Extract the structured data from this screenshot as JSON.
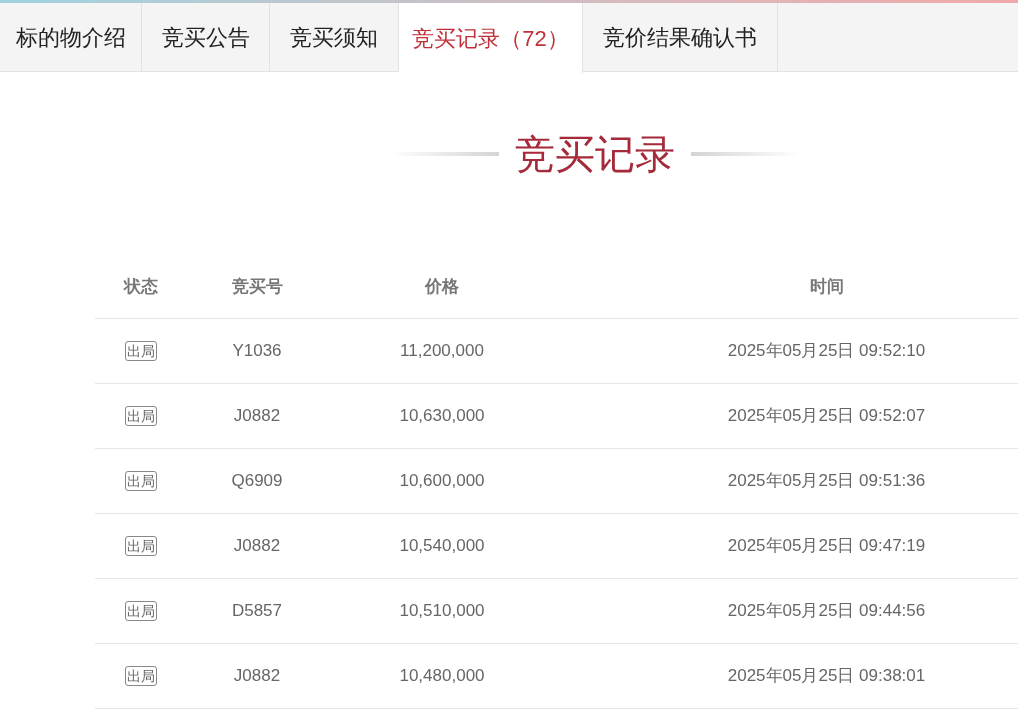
{
  "tabs": [
    {
      "label": "标的物介绍",
      "selected": false
    },
    {
      "label": "竞买公告",
      "selected": false
    },
    {
      "label": "竞买须知",
      "selected": false
    },
    {
      "label": "竞买记录（72）",
      "selected": true
    },
    {
      "label": "竞价结果确认书",
      "selected": false
    }
  ],
  "section_title": "竞买记录",
  "table": {
    "columns": [
      "状态",
      "竞买号",
      "价格",
      "时间"
    ],
    "rows": [
      {
        "status": "出局",
        "bidder": "Y1036",
        "price": "11,200,000",
        "time": "2025年05月25日 09:52:10"
      },
      {
        "status": "出局",
        "bidder": "J0882",
        "price": "10,630,000",
        "time": "2025年05月25日 09:52:07"
      },
      {
        "status": "出局",
        "bidder": "Q6909",
        "price": "10,600,000",
        "time": "2025年05月25日 09:51:36"
      },
      {
        "status": "出局",
        "bidder": "J0882",
        "price": "10,540,000",
        "time": "2025年05月25日 09:47:19"
      },
      {
        "status": "出局",
        "bidder": "D5857",
        "price": "10,510,000",
        "time": "2025年05月25日 09:44:56"
      },
      {
        "status": "出局",
        "bidder": "J0882",
        "price": "10,480,000",
        "time": "2025年05月25日 09:38:01"
      }
    ]
  }
}
